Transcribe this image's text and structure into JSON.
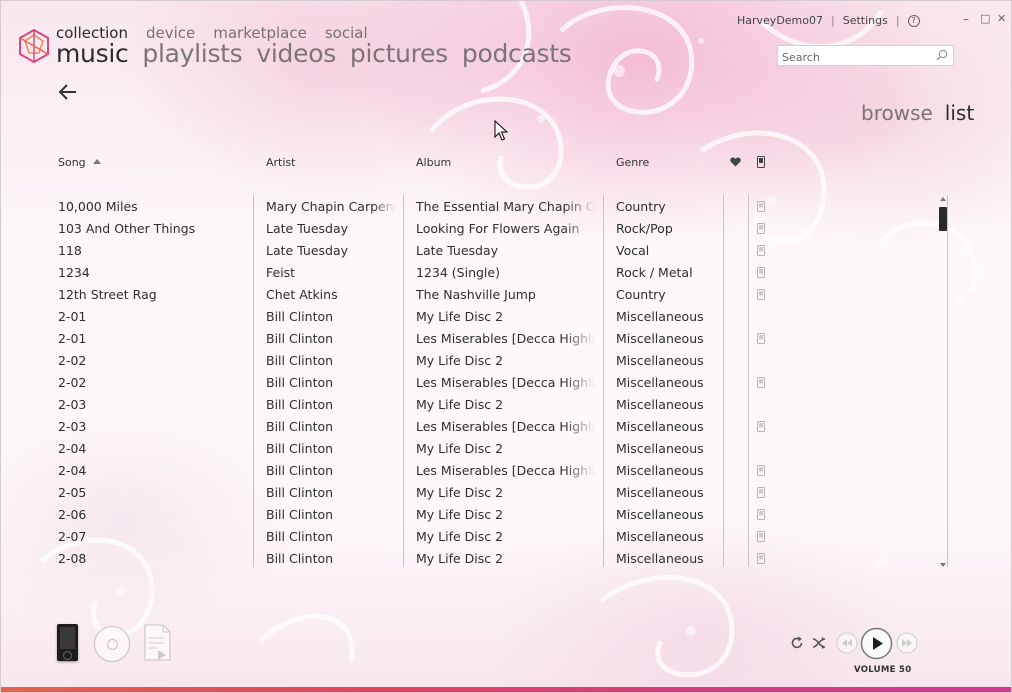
{
  "colors": {
    "accent_strip": "#e0457a",
    "text": "#2e2e2e",
    "muted": "#7a7276"
  },
  "nav": {
    "top_items": [
      "collection",
      "device",
      "marketplace",
      "social"
    ],
    "sub_items": [
      "music",
      "playlists",
      "videos",
      "pictures",
      "podcasts"
    ]
  },
  "user": {
    "name": "HarveyDemo07",
    "settings": "Settings",
    "help": "?"
  },
  "window": {
    "minimize": "–",
    "maximize": "□",
    "close": "✕"
  },
  "search": {
    "placeholder": "Search",
    "value": ""
  },
  "view": {
    "browse": "browse",
    "list": "list"
  },
  "table": {
    "headers": {
      "song": "Song",
      "artist": "Artist",
      "album": "Album",
      "genre": "Genre"
    },
    "header_icons": [
      "heart-icon",
      "device-icon"
    ],
    "rows": [
      {
        "song": "10,000 Miles",
        "artist": "Mary Chapin Carpenter",
        "album": "The Essential Mary Chapin Carpenter",
        "genre": "Country",
        "on_device": true
      },
      {
        "song": "103 And Other Things",
        "artist": "Late Tuesday",
        "album": "Looking For Flowers Again",
        "genre": "Rock/Pop",
        "on_device": true
      },
      {
        "song": "118",
        "artist": "Late Tuesday",
        "album": "Late Tuesday",
        "genre": "Vocal",
        "on_device": true
      },
      {
        "song": "1234",
        "artist": "Feist",
        "album": "1234 (Single)",
        "genre": "Rock / Metal",
        "on_device": true
      },
      {
        "song": "12th Street Rag",
        "artist": "Chet Atkins",
        "album": "The Nashville Jump",
        "genre": "Country",
        "on_device": true
      },
      {
        "song": "2-01",
        "artist": "Bill Clinton",
        "album": "My Life Disc 2",
        "genre": "Miscellaneous",
        "on_device": false
      },
      {
        "song": "2-01",
        "artist": "Bill Clinton",
        "album": "Les Miserables [Decca Highlights]",
        "genre": "Miscellaneous",
        "on_device": true
      },
      {
        "song": "2-02",
        "artist": "Bill Clinton",
        "album": "My Life Disc 2",
        "genre": "Miscellaneous",
        "on_device": false
      },
      {
        "song": "2-02",
        "artist": "Bill Clinton",
        "album": "Les Miserables [Decca Highlights]",
        "genre": "Miscellaneous",
        "on_device": true
      },
      {
        "song": "2-03",
        "artist": "Bill Clinton",
        "album": "My Life Disc 2",
        "genre": "Miscellaneous",
        "on_device": false
      },
      {
        "song": "2-03",
        "artist": "Bill Clinton",
        "album": "Les Miserables [Decca Highlights]",
        "genre": "Miscellaneous",
        "on_device": true
      },
      {
        "song": "2-04",
        "artist": "Bill Clinton",
        "album": "My Life Disc 2",
        "genre": "Miscellaneous",
        "on_device": false
      },
      {
        "song": "2-04",
        "artist": "Bill Clinton",
        "album": "Les Miserables [Decca Highlights]",
        "genre": "Miscellaneous",
        "on_device": true
      },
      {
        "song": "2-05",
        "artist": "Bill Clinton",
        "album": "My Life Disc 2",
        "genre": "Miscellaneous",
        "on_device": true
      },
      {
        "song": "2-06",
        "artist": "Bill Clinton",
        "album": "My Life Disc 2",
        "genre": "Miscellaneous",
        "on_device": true
      },
      {
        "song": "2-07",
        "artist": "Bill Clinton",
        "album": "My Life Disc 2",
        "genre": "Miscellaneous",
        "on_device": true
      },
      {
        "song": "2-08",
        "artist": "Bill Clinton",
        "album": "My Life Disc 2",
        "genre": "Miscellaneous",
        "on_device": true
      }
    ]
  },
  "player": {
    "volume_label": "VOLUME 50"
  }
}
